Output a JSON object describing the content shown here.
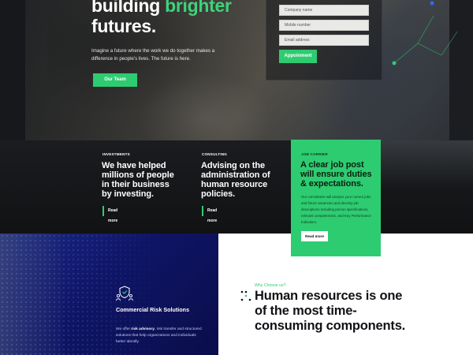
{
  "hero": {
    "title_part1": "building ",
    "title_accent": "brighter",
    "title_part2": "futures.",
    "description": "Imagine a future where the work we do together makes a difference in people's lives. The future is here.",
    "button_label": "Our Team"
  },
  "form": {
    "fields": [
      {
        "placeholder": "Company name"
      },
      {
        "placeholder": "Mobile number"
      },
      {
        "placeholder": "Email address"
      }
    ],
    "submit_label": "Appoinment"
  },
  "cards": [
    {
      "tag": "INVESTMENTS",
      "title": "We have helped millions of people in their business by investing.",
      "link": "Read more"
    },
    {
      "tag": "CONSULTING",
      "title": "Advising on the administration of human resource policies.",
      "link": "Read more"
    },
    {
      "tag": "JOB CARRIER",
      "title": "A clear job post will ensure duties & expectations.",
      "body": "Our consultants will analyze your current jobs and future vacancies and develop job descriptions including person specifications, relevant competencies, and Key Performance Indicators.",
      "link": "Read more"
    }
  ],
  "promo": {
    "title": "Commercial Risk Solutions",
    "body_pre": "We offer ",
    "body_bold": "risk advisory",
    "body_post": ", risk transfer and structured solutions that help organizations and individuals better identify.",
    "icon": "shield-people-icon"
  },
  "why": {
    "label": "Why Choose us?",
    "title": "Human resources is one of the most time-consuming components."
  },
  "colors": {
    "accent_green": "#2ecc71",
    "navy": "#0f1566",
    "dark": "#141518"
  }
}
